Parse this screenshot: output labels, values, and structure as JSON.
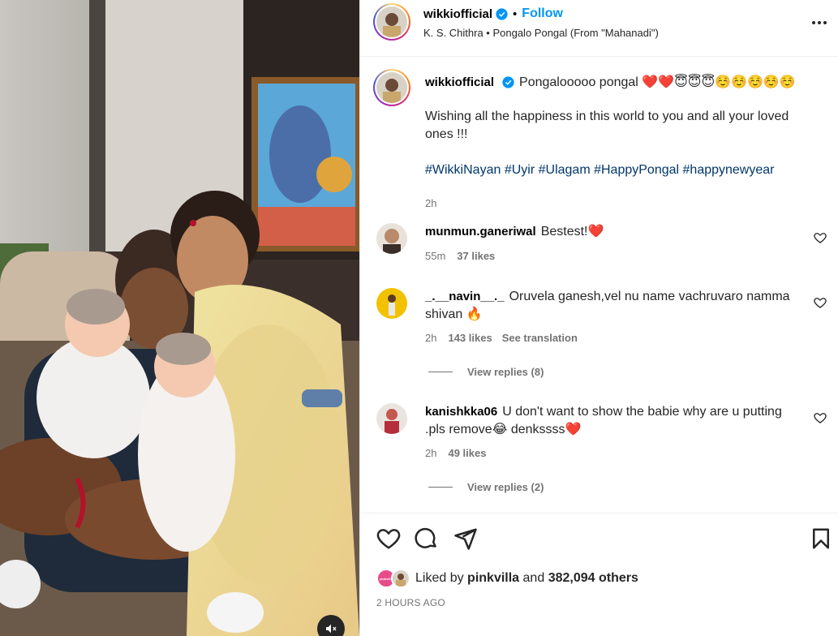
{
  "post": {
    "username": "wikkiofficial",
    "follow_label": "Follow",
    "separator": "•",
    "audio": "K. S. Chithra • Pongalo Pongal (From \"Mahanadi\")",
    "more_icon": "more-horizontal-icon"
  },
  "caption": {
    "username": "wikkiofficial",
    "line1": "Pongalooooo pongal ❤️❤️😇😇😇☺️☺️☺️☺️☺️",
    "line2": "Wishing all the happiness in this world to you and all your loved ones !!!",
    "hashtags": [
      "#WikkiNayan",
      "#Uyir",
      "#Ulagam",
      "#HappyPongal",
      "#happynewyear"
    ],
    "time": "2h"
  },
  "comments": [
    {
      "username": "munmun.ganeriwal",
      "text": "Bestest!❤️",
      "time": "55m",
      "likes": "37 likes",
      "translate": "",
      "replies": ""
    },
    {
      "username": "_.__navin__._",
      "text": "Oruvela ganesh,vel nu name vachruvaro namma shivan 🔥",
      "time": "2h",
      "likes": "143 likes",
      "translate": "See translation",
      "replies": "View replies (8)"
    },
    {
      "username": "kanishkka06",
      "text": "U don't want to show the babie why are u putting .pls remove😂 denkssss❤️",
      "time": "2h",
      "likes": "49 likes",
      "translate": "",
      "replies": "View replies (2)"
    }
  ],
  "actions": {
    "like_icon": "heart-icon",
    "comment_icon": "comment-icon",
    "share_icon": "share-icon",
    "save_icon": "bookmark-icon"
  },
  "likes": {
    "prefix": "Liked by",
    "user": "pinkvilla",
    "middle": "and",
    "others": "382,094 others",
    "mini_avatar_text": "pinkvilla"
  },
  "timestamp": "2 HOURS AGO",
  "media": {
    "mute_icon": "muted-speaker-icon"
  },
  "colors": {
    "accent": "#0095f6",
    "verified": "#0095f6",
    "link": "#00376b",
    "meta": "#737373"
  }
}
